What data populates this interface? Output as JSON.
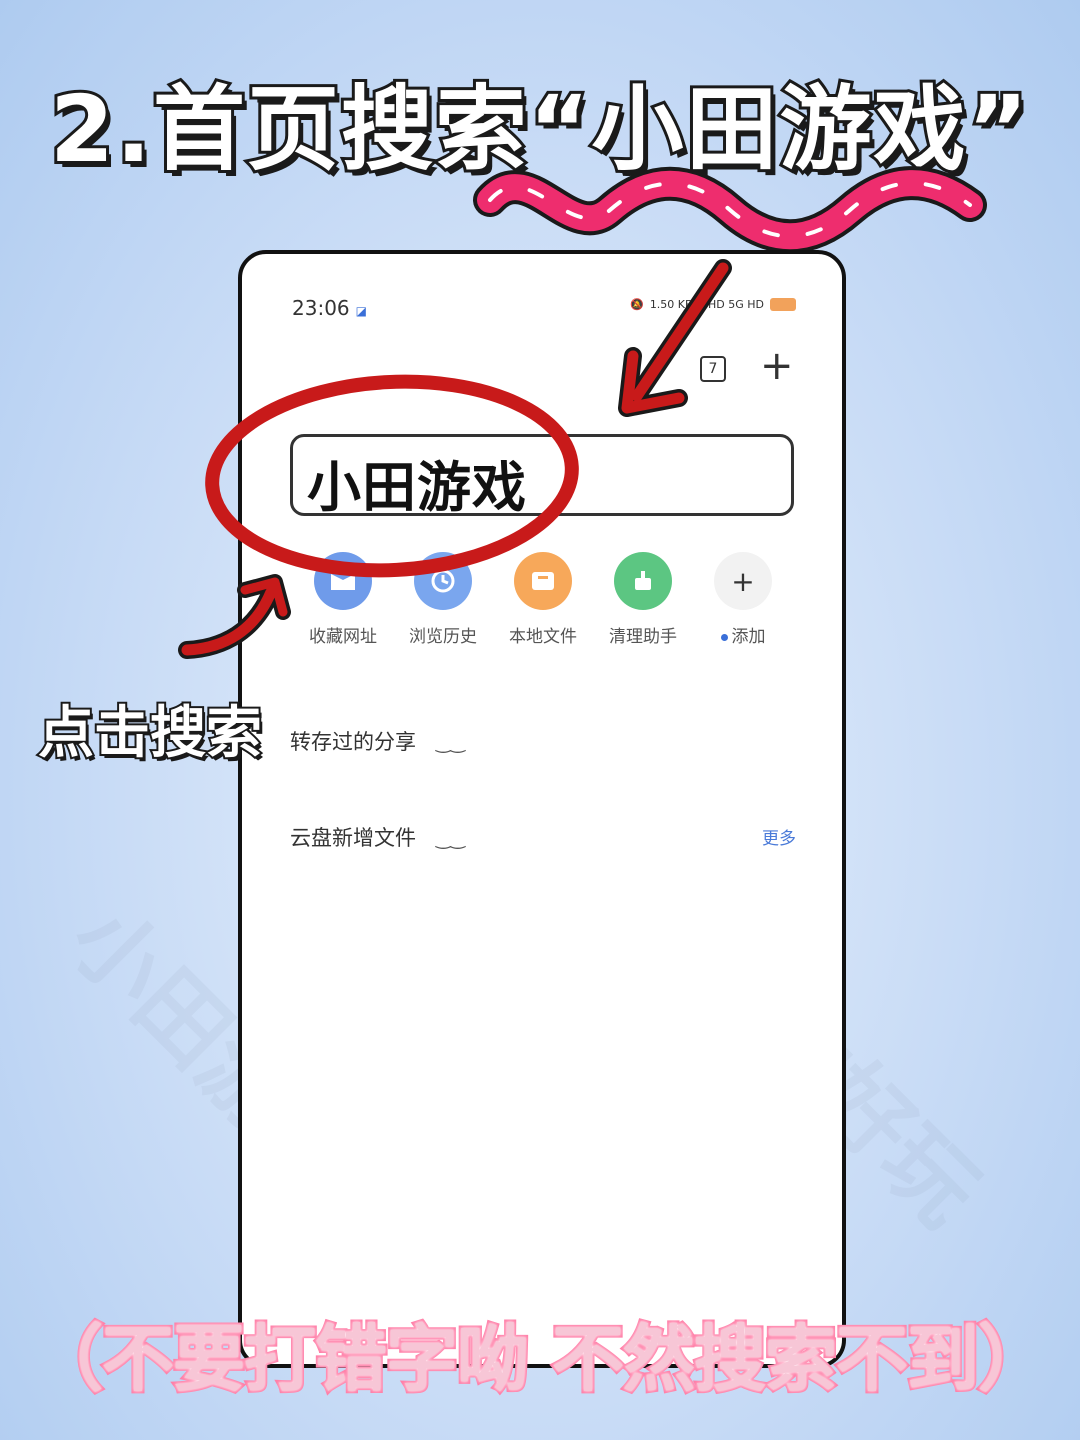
{
  "headline": "2.首页搜索“小田游戏”",
  "status_bar": {
    "time": "23:06",
    "network": "1.50 KB/s",
    "signal_labels": "HD 5G HD"
  },
  "toolbar": {
    "tab_count": "7",
    "add_label": "+"
  },
  "search": {
    "value": "小田游戏"
  },
  "shortcuts": [
    {
      "label": "收藏网址",
      "color": "#6f9bea"
    },
    {
      "label": "浏览历史",
      "color": "#7aa6ee"
    },
    {
      "label": "本地文件",
      "color": "#f7a85a"
    },
    {
      "label": "清理助手",
      "color": "#5cc682"
    },
    {
      "label": "添加",
      "color": "#f2f2f2",
      "icon": "+"
    }
  ],
  "sections": {
    "shared": "转存过的分享",
    "cloud": "云盘新增文件",
    "more": "更多",
    "eye_icon": "‿‿"
  },
  "side_label": "点击搜索",
  "bottom_note": "（不要打错字呦 不然搜索不到）",
  "watermarks": [
    "小田游戏",
    "真的好玩"
  ],
  "colors": {
    "ellipse": "#c81a1a",
    "arrow": "#c81a1a",
    "wave": "#ee2d6e"
  }
}
